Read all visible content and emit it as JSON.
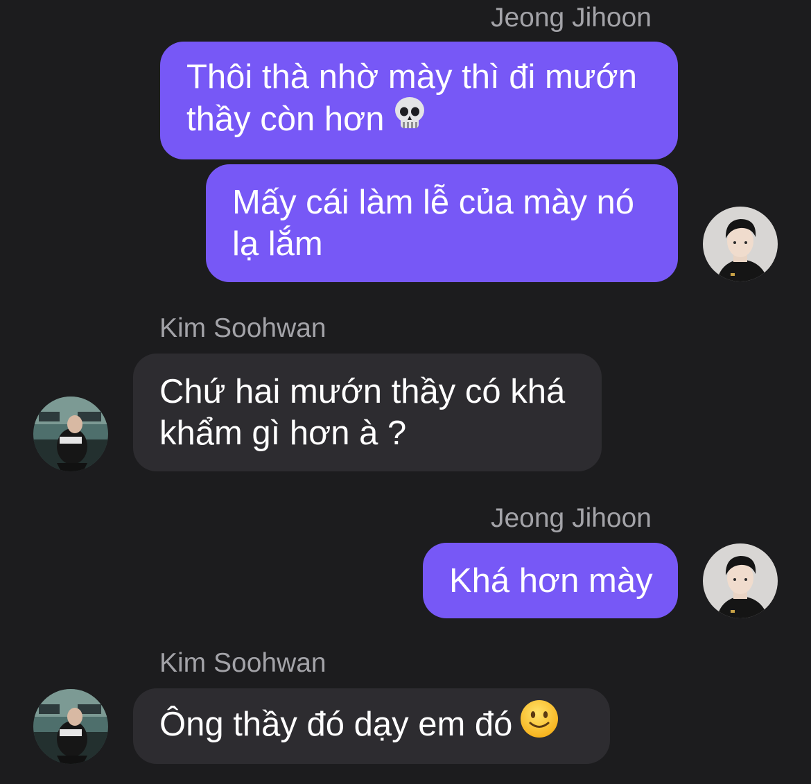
{
  "conversation": {
    "messages": [
      {
        "sender": "Jeong Jihoon",
        "direction": "out",
        "lines": [
          "Thôi thà nhờ mày thì đi mướn",
          "thầy còn hơn"
        ],
        "emoji": "skull-emoji"
      },
      {
        "direction": "out",
        "lines": [
          "Mấy cái làm lễ của mày nó",
          "lạ lắm"
        ]
      },
      {
        "sender": "Kim Soohwan",
        "direction": "in",
        "lines": [
          "Chứ hai mướn thầy có khá",
          "khẩm gì hơn à ?"
        ]
      },
      {
        "sender": "Jeong Jihoon",
        "direction": "out",
        "lines": [
          "Khá hơn mày"
        ]
      },
      {
        "sender": "Kim Soohwan",
        "direction": "in",
        "lines": [
          "Ông thầy đó dạy em đó"
        ],
        "emoji": "slightly-smiling-face-emoji"
      }
    ]
  },
  "colors": {
    "background": "#1c1c1e",
    "outgoing_bubble": "#7758f6",
    "incoming_bubble": "#2d2c30",
    "sender_name": "#a3a3a8",
    "text": "#ffffff"
  }
}
